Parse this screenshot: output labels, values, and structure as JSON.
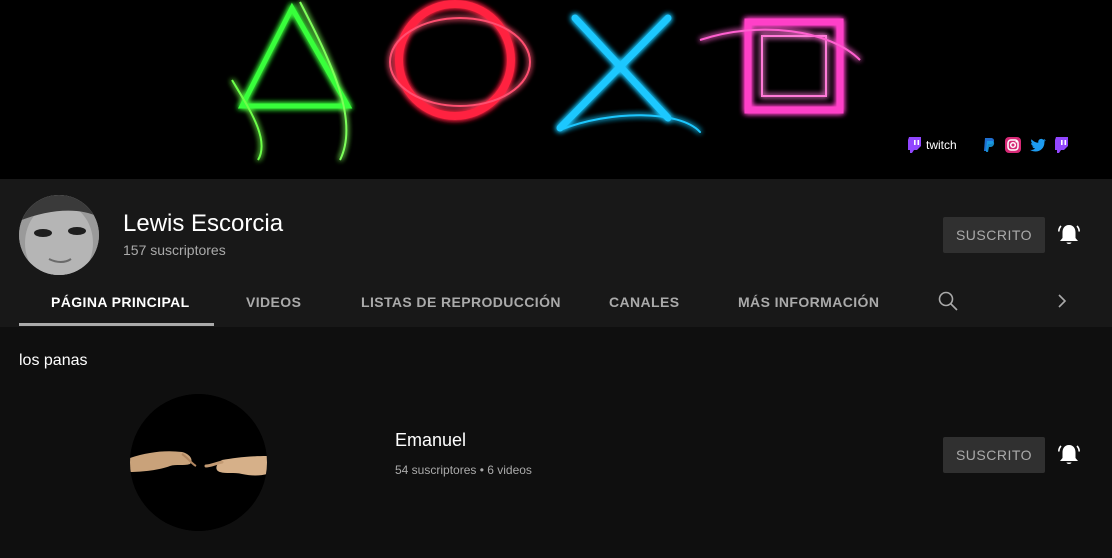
{
  "banner": {
    "links": [
      {
        "icon": "twitch-icon",
        "label": "twitch"
      },
      {
        "icon": "paypal-icon",
        "label": ""
      },
      {
        "icon": "instagram-icon",
        "label": ""
      },
      {
        "icon": "twitter-icon",
        "label": ""
      },
      {
        "icon": "twitch-icon",
        "label": ""
      }
    ]
  },
  "channel": {
    "name": "Lewis Escorcia",
    "subscribers": "157 suscriptores",
    "subscribe_label": "SUSCRITO",
    "bell_icon": "bell-icon"
  },
  "tabs": [
    {
      "label": "PÁGINA PRINCIPAL",
      "active": true
    },
    {
      "label": "VIDEOS",
      "active": false
    },
    {
      "label": "LISTAS DE REPRODUCCIÓN",
      "active": false
    },
    {
      "label": "CANALES",
      "active": false
    },
    {
      "label": "MÁS INFORMACIÓN",
      "active": false
    }
  ],
  "tab_icons": {
    "search": "search-icon",
    "next": "chevron-right-icon"
  },
  "section": {
    "title": "los panas",
    "items": [
      {
        "name": "Emanuel",
        "meta": "54 suscriptores • 6 videos",
        "subscribe_label": "SUSCRITO"
      }
    ]
  },
  "colors": {
    "background": "#181818",
    "content_background": "#0f0f0f",
    "button_background": "#303030",
    "secondary_text": "#aaaaaa",
    "triangle": "#39ff3a",
    "circle": "#ff2040",
    "cross": "#1ec8ff",
    "square": "#ff40c8"
  }
}
